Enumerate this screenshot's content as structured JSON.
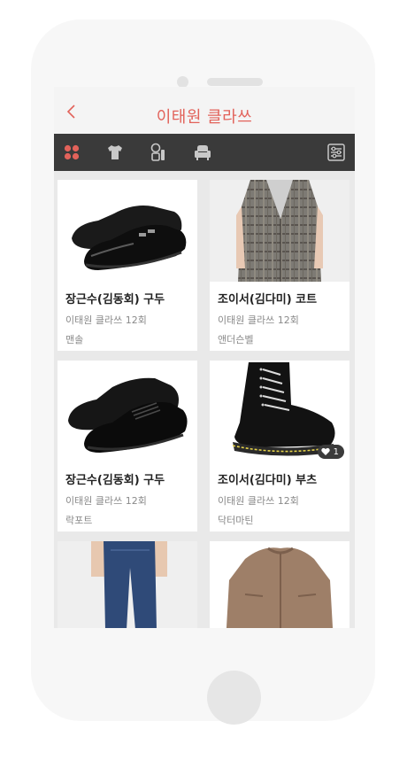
{
  "header": {
    "title": "이태원 클라쓰"
  },
  "tabs": [
    {
      "name": "all",
      "icon": "grid-dots-icon",
      "active": true
    },
    {
      "name": "tops",
      "icon": "tshirt-icon",
      "active": false
    },
    {
      "name": "beauty",
      "icon": "cosmetics-icon",
      "active": false
    },
    {
      "name": "furniture",
      "icon": "armchair-icon",
      "active": false
    },
    {
      "name": "filter",
      "icon": "sliders-icon",
      "active": false
    }
  ],
  "products": [
    {
      "name": "장근수(김동회) 구두",
      "show": "이태원 클라쓰 12회",
      "brand": "맨솔"
    },
    {
      "name": "조이서(김다미) 코트",
      "show": "이태원 클라쓰 12회",
      "brand": "앤더슨벨"
    },
    {
      "name": "장근수(김동회) 구두",
      "show": "이태원 클라쓰 12회",
      "brand": "락포트"
    },
    {
      "name": "조이서(김다미) 부츠",
      "show": "이태원 클라쓰 12회",
      "brand": "닥터마틴",
      "likes": "1"
    },
    {
      "name": "",
      "show": "",
      "brand": ""
    },
    {
      "name": "",
      "show": "",
      "brand": ""
    }
  ],
  "colors": {
    "accent": "#e2625a",
    "tabbar": "#3a3a3a"
  }
}
